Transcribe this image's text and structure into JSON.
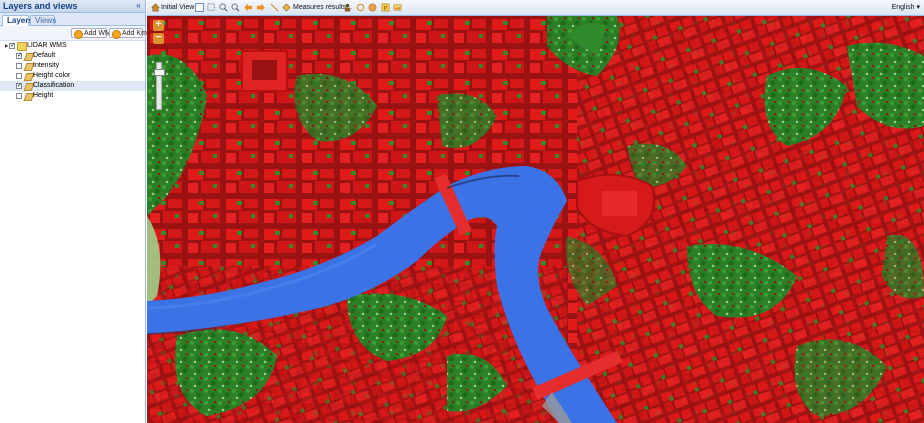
{
  "panel": {
    "title": "Layers and views",
    "collapse_icon": "«",
    "tabs": [
      {
        "label": "Layers",
        "active": true
      },
      {
        "label": "Views",
        "active": false
      }
    ],
    "toolbar": {
      "add_wms_label": "Add WMS",
      "add_kml_label": "Add Kml"
    }
  },
  "tree": {
    "root": {
      "label": "LIDAR WMS",
      "checked": true,
      "expander": "▲"
    },
    "layers": [
      {
        "label": "Default",
        "checked": true,
        "selected": false
      },
      {
        "label": "Intensity",
        "checked": false,
        "selected": false
      },
      {
        "label": "Height color",
        "checked": false,
        "selected": false
      },
      {
        "label": "Classification",
        "checked": true,
        "selected": true
      },
      {
        "label": "Height",
        "checked": false,
        "selected": false
      }
    ]
  },
  "map_toolbar": {
    "initial_view_label": "Initial View",
    "measures_label": "Measures results...",
    "language": "English ▾"
  },
  "map": {
    "zoom_in": "+",
    "zoom_out": "−",
    "colors": {
      "building": "#e01919",
      "ground": "#9b1212",
      "vegetation": "#2f8a2a",
      "low_vegetation": "#9ed088",
      "water": "#3b73e6",
      "bridge": "#e52d2d"
    }
  }
}
